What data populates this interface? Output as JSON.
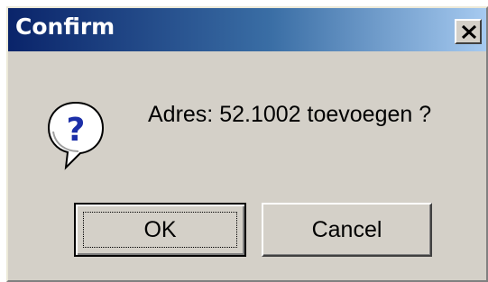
{
  "window": {
    "title": "Confirm",
    "close_icon": "close-x-icon"
  },
  "dialog": {
    "icon": "question-icon",
    "message": "Adres: 52.1002 toevoegen ?"
  },
  "buttons": {
    "ok_label": "OK",
    "cancel_label": "Cancel"
  },
  "colors": {
    "titlebar_start": "#0a246a",
    "titlebar_end": "#a6caf0",
    "face": "#d4d0c8"
  }
}
